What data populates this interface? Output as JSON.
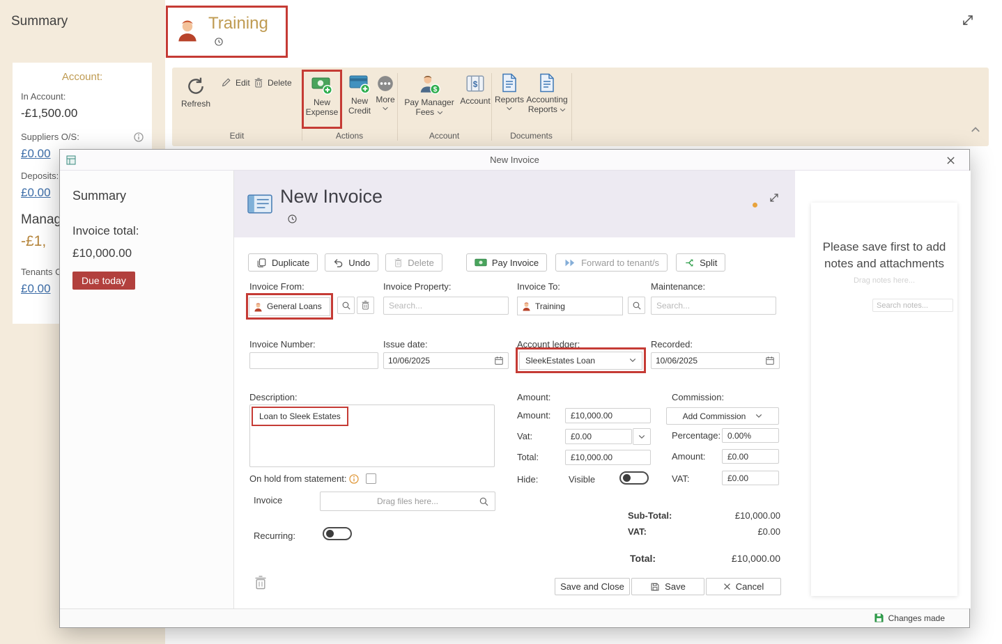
{
  "colors": {
    "annotation_red": "#c53b35",
    "badge_red": "#b2403d",
    "gold": "#bf9b52",
    "link_blue": "#3c6da8",
    "status_green": "#2fa04c"
  },
  "sidebar": {
    "title": "Summary",
    "card": {
      "heading": "Account:",
      "in_account_label": "In Account:",
      "in_account_value": "-£1,500.00",
      "suppliers_label": "Suppliers O/S:",
      "suppliers_value": "£0.00",
      "deposits_label": "Deposits:",
      "deposits_value": "£0.00",
      "management_label": "Manag",
      "management_value": "-£1,",
      "tenants_label": "Tenants C",
      "tenants_value": "£0.00"
    }
  },
  "header": {
    "title": "Training"
  },
  "ribbon": {
    "refresh_label": "Refresh",
    "edit_label": "Edit",
    "delete_label": "Delete",
    "new_expense_l1": "New",
    "new_expense_l2": "Expense",
    "new_credit_l1": "New",
    "new_credit_l2": "Credit",
    "more_label": "More",
    "pay_manager_l1": "Pay Manager",
    "pay_manager_l2": "Fees",
    "account_label": "Account",
    "reports_label": "Reports",
    "accounting_l1": "Accounting",
    "accounting_l2": "Reports",
    "group_edit": "Edit",
    "group_actions": "Actions",
    "group_account": "Account",
    "group_documents": "Documents"
  },
  "modal": {
    "title": "New Invoice",
    "summary": {
      "title": "Summary",
      "total_label": "Invoice total:",
      "total_value": "£10,000.00",
      "due_badge": "Due today"
    },
    "heading": "New Invoice",
    "toolbar": {
      "duplicate": "Duplicate",
      "undo": "Undo",
      "delete": "Delete",
      "pay_invoice": "Pay Invoice",
      "forward": "Forward to tenant/s",
      "split": "Split"
    },
    "form": {
      "invoice_from_label": "Invoice From:",
      "invoice_from_value": "General Loans",
      "invoice_property_label": "Invoice Property:",
      "invoice_property_placeholder": "Search...",
      "invoice_to_label": "Invoice To:",
      "invoice_to_value": "Training",
      "maintenance_label": "Maintenance:",
      "maintenance_placeholder": "Search...",
      "invoice_number_label": "Invoice Number:",
      "issue_date_label": "Issue date:",
      "issue_date_value": "10/06/2025",
      "account_ledger_label": "Account ledger:",
      "account_ledger_value": "SleekEstates Loan",
      "recorded_label": "Recorded:",
      "recorded_value": "10/06/2025",
      "description_label": "Description:",
      "description_value": "Loan to Sleek Estates",
      "amount_heading": "Amount:",
      "amount_label": "Amount:",
      "amount_value": "£10,000.00",
      "vat_label": "Vat:",
      "vat_value": "£0.00",
      "total_label": "Total:",
      "total_value": "£10,000.00",
      "hide_label": "Hide:",
      "hide_state": "Visible",
      "commission_heading": "Commission:",
      "add_commission": "Add Commission",
      "percentage_label": "Percentage:",
      "percentage_value": "0.00%",
      "commission_amount_label": "Amount:",
      "commission_amount_value": "£0.00",
      "commission_vat_label": "VAT:",
      "commission_vat_value": "£0.00",
      "on_hold_label": "On hold from statement:",
      "invoice_attach_label": "Invoice",
      "drag_files_placeholder": "Drag files here...",
      "recurring_label": "Recurring:"
    },
    "totals": {
      "subtotal_label": "Sub-Total:",
      "subtotal_value": "£10,000.00",
      "vat_label": "VAT:",
      "vat_value": "£0.00",
      "total_label": "Total:",
      "total_value": "£10,000.00"
    },
    "actions": {
      "save_close": "Save and Close",
      "save": "Save",
      "cancel": "Cancel"
    },
    "notes": {
      "message": "Please save first to add notes and attachments",
      "drag_placeholder": "Drag notes here...",
      "search_placeholder": "Search notes..."
    },
    "footer_status": "Changes made"
  }
}
